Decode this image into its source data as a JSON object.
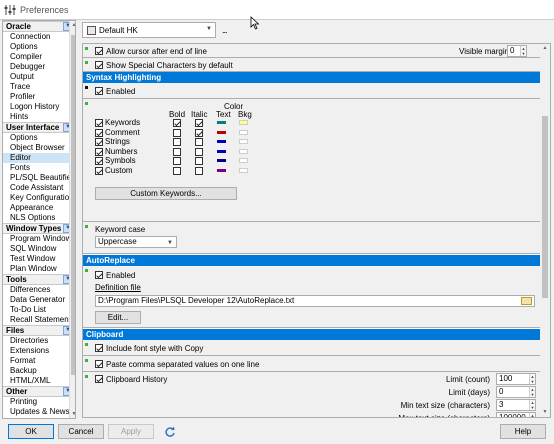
{
  "window": {
    "title": "Preferences"
  },
  "profile": {
    "value": "Default HK",
    "more": "..."
  },
  "left_groups": [
    {
      "label": "Oracle",
      "items": [
        "Connection",
        "Options",
        "Compiler",
        "Debugger",
        "Output",
        "Trace",
        "Profiler",
        "Logon History",
        "Hints"
      ]
    },
    {
      "label": "User Interface",
      "items": [
        "Options",
        "Object Browser",
        "Editor",
        "Fonts",
        "PL/SQL Beautifier",
        "Code Assistant",
        "Key Configuration",
        "Appearance",
        "NLS Options"
      ]
    },
    {
      "label": "Window Types",
      "items": [
        "Program Window",
        "SQL Window",
        "Test Window",
        "Plan Window"
      ]
    },
    {
      "label": "Tools",
      "items": [
        "Differences",
        "Data Generator",
        "To-Do List",
        "Recall Statement"
      ]
    },
    {
      "label": "Files",
      "items": [
        "Directories",
        "Extensions",
        "Format",
        "Backup",
        "HTML/XML"
      ]
    },
    {
      "label": "Other",
      "items": [
        "Printing",
        "Updates & News"
      ]
    }
  ],
  "selected_item": "Editor",
  "editor": {
    "allow_cursor": "Allow cursor after end of line",
    "visible_margin_label": "Visible margin",
    "visible_margin_value": "0",
    "show_special": "Show Special Characters by default"
  },
  "syntax": {
    "header": "Syntax Highlighting",
    "enabled": "Enabled",
    "col_bold": "Bold",
    "col_italic": "Italic",
    "col_color": "Color",
    "col_text": "Text",
    "col_bkg": "Bkg",
    "rows": [
      {
        "label": "Keywords",
        "bold": true,
        "italic": true,
        "text_color": "#008080",
        "bkg_color": "#ffff80"
      },
      {
        "label": "Comment",
        "bold": false,
        "italic": true,
        "text_color": "#c00000",
        "bkg_color": "#ffffff"
      },
      {
        "label": "Strings",
        "bold": false,
        "italic": false,
        "text_color": "#0000c0",
        "bkg_color": "#ffffff"
      },
      {
        "label": "Numbers",
        "bold": false,
        "italic": false,
        "text_color": "#0000c0",
        "bkg_color": "#ffffff"
      },
      {
        "label": "Symbols",
        "bold": false,
        "italic": false,
        "text_color": "#000080",
        "bkg_color": "#ffffff"
      },
      {
        "label": "Custom",
        "bold": false,
        "italic": false,
        "text_color": "#800080",
        "bkg_color": "#ffffff"
      }
    ],
    "custom_keywords_button": "Custom Keywords..."
  },
  "keyword_case": {
    "label": "Keyword case",
    "value": "Uppercase"
  },
  "autoreplace": {
    "header": "AutoReplace",
    "enabled": "Enabled",
    "definition_label": "Definition file",
    "definition_value": "D:\\Program Files\\PLSQL Developer 12\\AutoReplace.txt",
    "edit_button": "Edit..."
  },
  "clipboard": {
    "header": "Clipboard",
    "include_font": "Include font style with Copy",
    "paste_comma": "Paste comma separated values on one line",
    "history": "Clipboard History",
    "fields": [
      {
        "label": "Limit (count)",
        "value": "100"
      },
      {
        "label": "Limit (days)",
        "value": "0"
      },
      {
        "label": "Min text size (characters)",
        "value": "3"
      },
      {
        "label": "Max text size (characters)",
        "value": "100000"
      }
    ]
  },
  "buttons": {
    "ok": "OK",
    "cancel": "Cancel",
    "apply": "Apply",
    "help": "Help"
  }
}
